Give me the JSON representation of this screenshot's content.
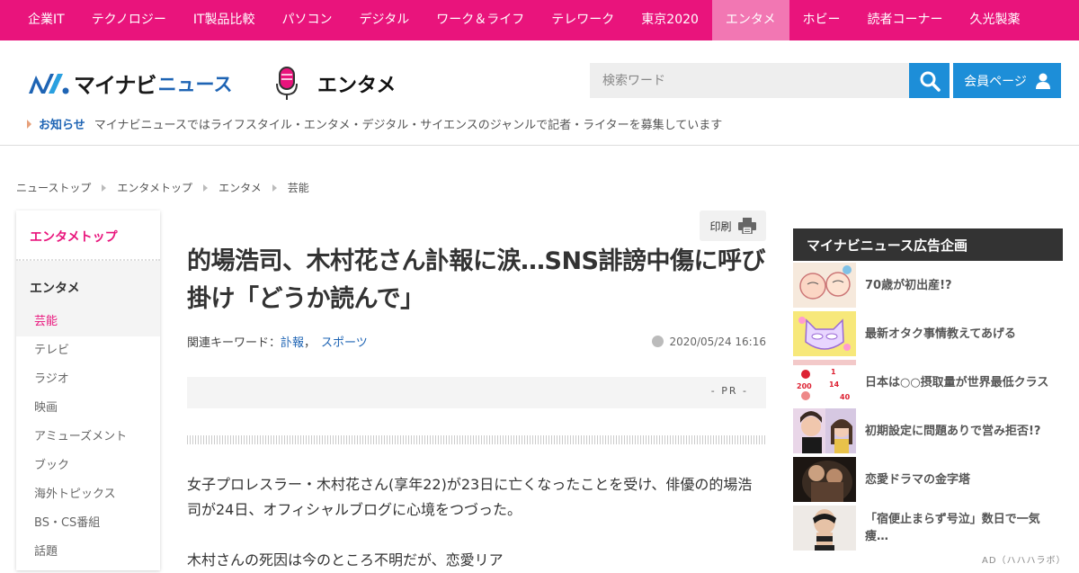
{
  "nav": {
    "items": [
      "企業IT",
      "テクノロジー",
      "IT製品比較",
      "パソコン",
      "デジタル",
      "ワーク＆ライフ",
      "テレワーク",
      "東京2020",
      "エンタメ",
      "ホビー",
      "読者コーナー",
      "久光製薬"
    ],
    "active": "エンタメ"
  },
  "header": {
    "logo_text": "マイナビ",
    "logo_sub": "ニュース",
    "section_name": "エンタメ",
    "search_placeholder": "検索ワード",
    "member_label": "会員ページ"
  },
  "notice": {
    "label": "お知らせ",
    "text": "マイナビニュースではライフスタイル・エンタメ・デジタル・サイエンスのジャンルで記者・ライターを募集しています"
  },
  "breadcrumb": [
    "ニューストップ",
    "エンタメトップ",
    "エンタメ",
    "芸能"
  ],
  "sidebar": {
    "top_link": "エンタメトップ",
    "heading": "エンタメ",
    "items": [
      "芸能",
      "テレビ",
      "ラジオ",
      "映画",
      "アミューズメント",
      "ブック",
      "海外トピックス",
      "BS・CS番組",
      "話題"
    ],
    "active": "芸能"
  },
  "article": {
    "print_label": "印刷",
    "title": "的場浩司、木村花さん訃報に涙…SNS誹謗中傷に呼び掛け「どうか読んで」",
    "keywords_label": "関連キーワード：",
    "keywords": [
      "訃報",
      "スポーツ"
    ],
    "keyword_sep": "，",
    "date": "2020/05/24 16:16",
    "pr_label": "- PR -",
    "paragraphs": [
      "女子プロレスラー・木村花さん(享年22)が23日に亡くなったことを受け、俳優の的場浩司が24日、オフィシャルブログに心境をつづった。",
      "木村さんの死因は今のところ不明だが、恋愛リア"
    ]
  },
  "ads": {
    "heading": "マイナビニュース広告企画",
    "items": [
      {
        "text": "70歳が初出産!?",
        "thumb": "manga-face"
      },
      {
        "text": "最新オタク事情教えてあげる",
        "thumb": "cat-mask"
      },
      {
        "text": "日本は○○摂取量が世界最低クラス",
        "thumb": "infographic",
        "thumb_text": [
          "1",
          "14",
          "40",
          "200"
        ]
      },
      {
        "text": "初期設定に問題ありで営み拒否!?",
        "thumb": "portrait"
      },
      {
        "text": "恋愛ドラマの金字塔",
        "thumb": "drama-still"
      },
      {
        "text": "「宿便止まらず号泣」数日で一気痩…",
        "thumb": "body-photo"
      }
    ],
    "credit": "AD（ハハハラボ）"
  },
  "colors": {
    "brand_pink": "#e9147c",
    "nav_active": "#f277b3",
    "action_blue": "#1d8ed8",
    "link_blue": "#1e64b4"
  }
}
